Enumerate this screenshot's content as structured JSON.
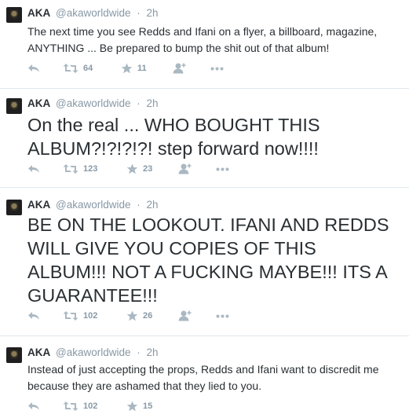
{
  "tweets": [
    {
      "name": "AKA",
      "handle": "@akaworldwide",
      "time": "2h",
      "text": "The next time you see Redds and Ifani on a flyer, a billboard, magazine, ANYTHING ... Be prepared to bump the shit out of that album!",
      "retweets": "64",
      "favorites": "11"
    },
    {
      "name": "AKA",
      "handle": "@akaworldwide",
      "time": "2h",
      "text": "On the real ... WHO BOUGHT THIS ALBUM?!?!?!?! step forward now!!!!",
      "retweets": "123",
      "favorites": "23"
    },
    {
      "name": "AKA",
      "handle": "@akaworldwide",
      "time": "2h",
      "text": "BE ON THE LOOKOUT. IFANI AND REDDS WILL GIVE YOU COPIES OF THIS ALBUM!!! NOT A FUCKING MAYBE!!! ITS A GUARANTEE!!!",
      "retweets": "102",
      "favorites": "26"
    },
    {
      "name": "AKA",
      "handle": "@akaworldwide",
      "time": "2h",
      "text": "Instead of just accepting the props, Redds and Ifani want to discredit me because they are ashamed that they lied to you.",
      "retweets": "102",
      "favorites": "15"
    }
  ],
  "icons": {
    "reply": "reply-icon",
    "retweet": "retweet-icon",
    "favorite": "star-icon",
    "follow": "follow-icon",
    "more": "more-icon"
  },
  "colors": {
    "text": "#292f33",
    "muted": "#8899a6",
    "icon": "#aab8c2",
    "divider": "#e1e8ed"
  }
}
